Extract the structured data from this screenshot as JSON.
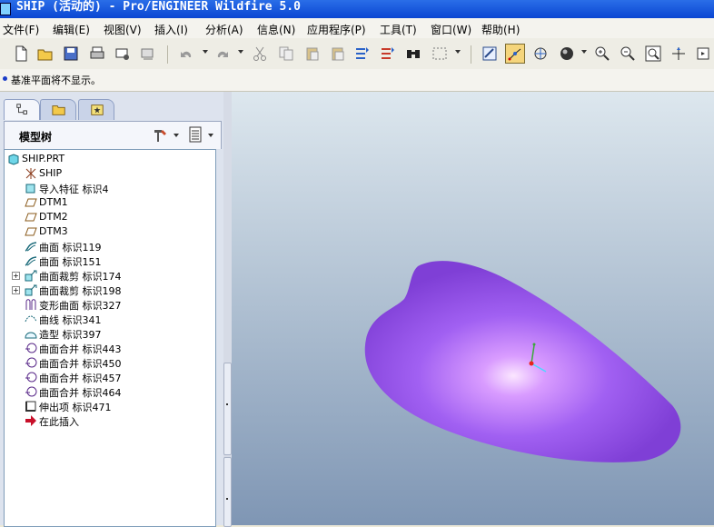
{
  "window": {
    "title": "SHIP (活动的) - Pro/ENGINEER Wildfire 5.0"
  },
  "menu": [
    {
      "label": "文件(F)"
    },
    {
      "label": "编辑(E)"
    },
    {
      "label": "视图(V)"
    },
    {
      "label": "插入(I)"
    },
    {
      "label": "分析(A)"
    },
    {
      "label": "信息(N)"
    },
    {
      "label": "应用程序(P)"
    },
    {
      "label": "工具(T)"
    },
    {
      "label": "窗口(W)"
    },
    {
      "label": "帮助(H)"
    }
  ],
  "toolbar_icons": [
    "new-icon",
    "open-icon",
    "save-icon",
    "print-icon",
    "send-mail-icon",
    "email-link-icon",
    "undo-icon",
    "redo-icon",
    "cut-icon",
    "copy-icon",
    "paste-icon",
    "paste-special-icon",
    "regenerate-icon",
    "regenerate-manager-icon",
    "find-icon",
    "select-box-icon",
    "redraw-icon",
    "spin-center-icon",
    "orient-mode-icon",
    "shading-icon",
    "zoom-in-icon",
    "zoom-out-icon",
    "refit-icon",
    "reorient-icon",
    "saved-views-icon"
  ],
  "message": {
    "text": "基准平面将不显示。"
  },
  "colors": {
    "accent": "#f5d57c",
    "model": "#9a5cf0",
    "title_bar": "#0a46d2"
  },
  "model_tree": {
    "title": "模型树",
    "items": [
      {
        "label": "SHIP.PRT",
        "icon": "part-icon"
      },
      {
        "label": "SHIP",
        "icon": "csys-icon"
      },
      {
        "label": "导入特征 标识4",
        "icon": "import-feature-icon"
      },
      {
        "label": "DTM1",
        "icon": "datum-plane-icon"
      },
      {
        "label": "DTM2",
        "icon": "datum-plane-icon"
      },
      {
        "label": "DTM3",
        "icon": "datum-plane-icon"
      },
      {
        "label": "曲面 标识119",
        "icon": "surface-icon"
      },
      {
        "label": "曲面 标识151",
        "icon": "surface-icon"
      },
      {
        "label": "曲面裁剪 标识174",
        "icon": "trim-icon"
      },
      {
        "label": "曲面裁剪 标识198",
        "icon": "trim-icon"
      },
      {
        "label": "变形曲面 标识327",
        "icon": "warp-icon"
      },
      {
        "label": "曲线 标识341",
        "icon": "curve-icon"
      },
      {
        "label": "造型 标识397",
        "icon": "style-icon"
      },
      {
        "label": "曲面合并 标识443",
        "icon": "merge-icon"
      },
      {
        "label": "曲面合并 标识450",
        "icon": "merge-icon"
      },
      {
        "label": "曲面合并 标识457",
        "icon": "merge-icon"
      },
      {
        "label": "曲面合并 标识464",
        "icon": "merge-icon"
      },
      {
        "label": "伸出项 标识471",
        "icon": "protrusion-icon"
      },
      {
        "label": "在此插入",
        "icon": "insert-here-icon"
      }
    ]
  }
}
